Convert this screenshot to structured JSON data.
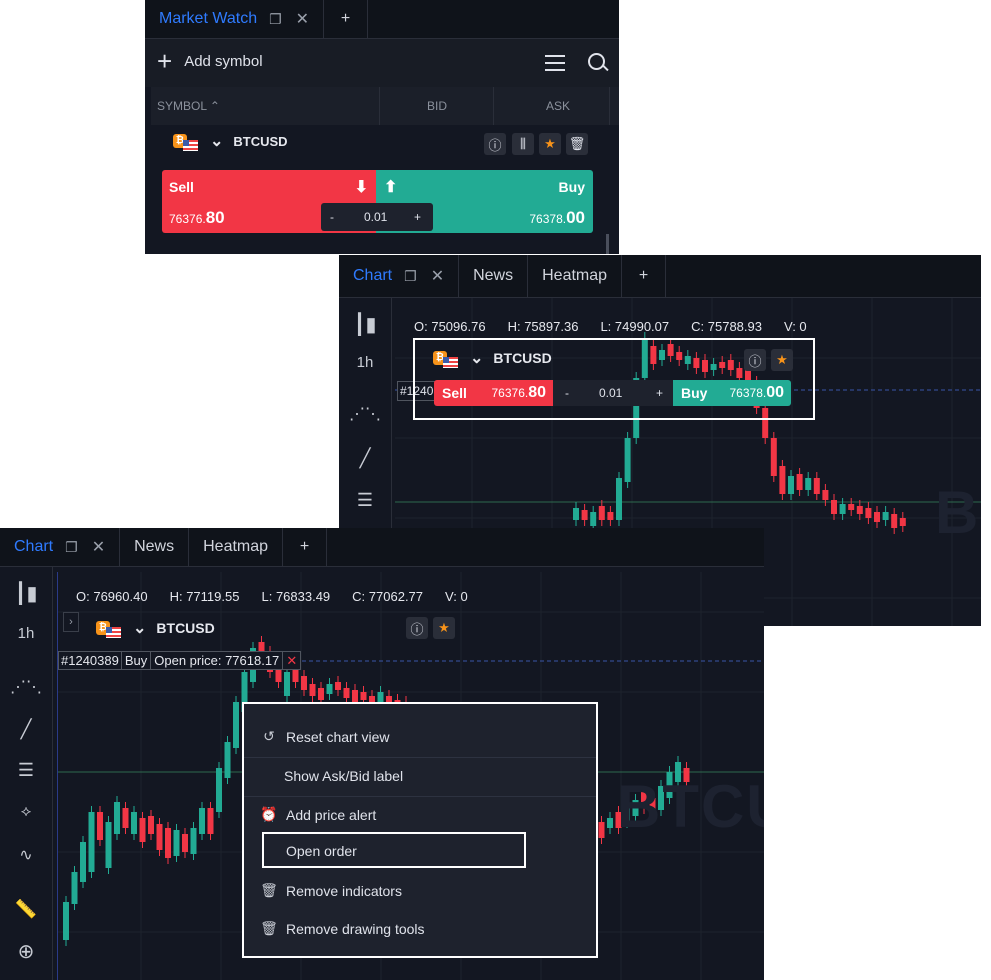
{
  "market_watch": {
    "tab_title": "Market Watch",
    "add_symbol": "Add symbol",
    "columns": [
      "SYMBOL",
      "BID",
      "ASK"
    ],
    "symbol": "BTCUSD",
    "sell_label": "Sell",
    "buy_label": "Buy",
    "sell_price_main": "76376.",
    "sell_price_big": "80",
    "buy_price_main": "76378.",
    "buy_price_big": "00",
    "volume": "0.01",
    "minus": "-",
    "plus": "+"
  },
  "chart_top": {
    "tabs": [
      "Chart",
      "News",
      "Heatmap"
    ],
    "plus": "+",
    "timeframe": "1h",
    "ohlc": {
      "o": "75096.76",
      "h": "75897.36",
      "l": "74990.07",
      "c": "75788.93",
      "v": "0"
    },
    "symbol": "BTCUSD",
    "order_partial": "#1240",
    "sell_label": "Sell",
    "sell_price_main": "76376.",
    "sell_price_big": "80",
    "volume": "0.01",
    "buy_label": "Buy",
    "buy_price_main": "76378.",
    "buy_price_big": "00",
    "minus": "-",
    "plus_vol": "+"
  },
  "chart_bottom": {
    "tabs": [
      "Chart",
      "News",
      "Heatmap"
    ],
    "plus": "+",
    "timeframe": "1h",
    "ohlc": {
      "o": "76960.40",
      "h": "77119.55",
      "l": "76833.49",
      "c": "77062.77",
      "v": "0"
    },
    "symbol": "BTCUSD",
    "order": {
      "id": "#1240389",
      "side": "Buy",
      "open_price": "Open price: 77618.17"
    },
    "watermark": "BTCU"
  },
  "context_menu": {
    "items": [
      {
        "label": "Reset chart view",
        "icon": "reset-icon"
      },
      {
        "label": "Show Ask/Bid label",
        "icon": ""
      },
      {
        "label": "Add price alert",
        "icon": "alarm-icon"
      },
      {
        "label": "Open order",
        "icon": ""
      },
      {
        "label": "Remove indicators",
        "icon": "trash-icon"
      },
      {
        "label": "Remove drawing tools",
        "icon": "trash-icon"
      }
    ]
  },
  "colors": {
    "sell": "#f23645",
    "buy": "#22ab94",
    "accent": "#2f7bff",
    "bg": "#131722"
  }
}
